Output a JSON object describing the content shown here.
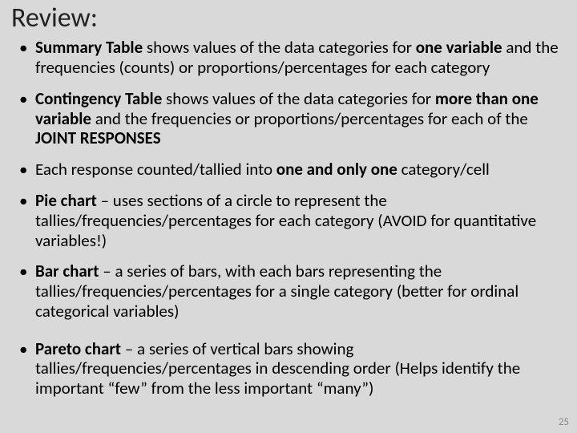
{
  "title": "Review:",
  "bullets": [
    {
      "lead_bold": "Summary Table",
      "mid1": " shows values of the data categories for ",
      "bold2": "one variable",
      "tail": " and the frequencies (counts) or proportions/percentages for each category"
    },
    {
      "lead_bold": "Contingency Table",
      "mid1": " shows values of the data categories for ",
      "bold2": "more than one variable",
      "mid2": " and the frequencies or proportions/percentages for each of the ",
      "bold3": "JOINT RESPONSES"
    },
    {
      "pre": "Each response counted/tallied into ",
      "bold1": "one and only one",
      "tail": " category/cell"
    },
    {
      "lead_bold": "Pie chart",
      "tail": " – uses sections of a circle to represent the tallies/frequencies/percentages for each category (AVOID for quantitative variables!)"
    },
    {
      "lead_bold": "Bar chart",
      "tail": " – a series of bars, with each bars representing the tallies/frequencies/percentages for a single category (better for ordinal categorical variables)"
    },
    {
      "lead_bold": "Pareto chart",
      "tail": " – a series of vertical bars showing tallies/frequencies/percentages in descending order (Helps identify the important “few” from the less important “many”)"
    }
  ],
  "page_number": "25"
}
